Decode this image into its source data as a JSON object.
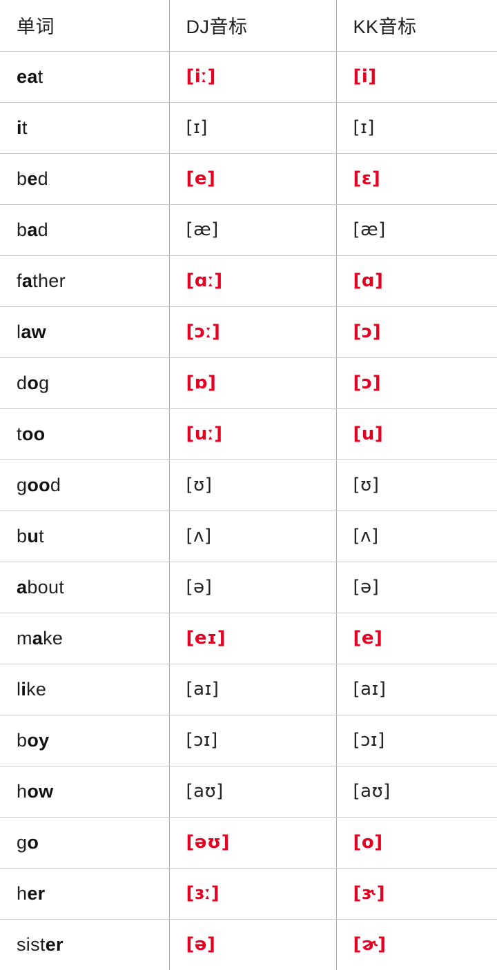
{
  "table": {
    "headers": {
      "word": "单词",
      "dj": "DJ音标",
      "kk": "KK音标"
    },
    "accent_color": "#e30021",
    "text_color": "#232323",
    "rows": [
      {
        "word": "eat",
        "word_bold": "ea",
        "word_rest": "t",
        "dj": "[iː]",
        "kk": "[i]",
        "dj_accent": true,
        "kk_accent": true
      },
      {
        "word": "it",
        "word_bold": "i",
        "word_rest": "t",
        "dj": "[ɪ]",
        "kk": "[ɪ]",
        "dj_accent": false,
        "kk_accent": false
      },
      {
        "word": "bed",
        "word_bold": "e",
        "word_rest": "d",
        "dj": "[e]",
        "kk": "[ɛ]",
        "dj_accent": true,
        "kk_accent": true
      },
      {
        "word": "bad",
        "word_bold": "a",
        "word_rest": "d",
        "dj": "[æ]",
        "kk": "[æ]",
        "dj_accent": false,
        "kk_accent": false
      },
      {
        "word": "father",
        "word_bold": "a",
        "word_rest": "ther",
        "dj": "[ɑː]",
        "kk": "[ɑ]",
        "dj_accent": true,
        "kk_accent": true
      },
      {
        "word": "law",
        "word_bold": "aw",
        "word_rest": "",
        "dj": "[ɔː]",
        "kk": "[ɔ]",
        "dj_accent": true,
        "kk_accent": true
      },
      {
        "word": "dog",
        "word_bold": "o",
        "word_rest": "g",
        "dj": "[ɒ]",
        "kk": "[ɔ]",
        "dj_accent": true,
        "kk_accent": true
      },
      {
        "word": "too",
        "word_bold": "oo",
        "word_rest": "",
        "dj": "[uː]",
        "kk": "[u]",
        "dj_accent": true,
        "kk_accent": true
      },
      {
        "word": "good",
        "word_bold": "oo",
        "word_rest": "d",
        "dj": "[ʊ]",
        "kk": "[ʊ]",
        "dj_accent": false,
        "kk_accent": false
      },
      {
        "word": "but",
        "word_bold": "u",
        "word_rest": "t",
        "dj": "[ʌ]",
        "kk": "[ʌ]",
        "dj_accent": false,
        "kk_accent": false
      },
      {
        "word": "about",
        "word_bold": "a",
        "word_rest": "bout",
        "dj": "[ə]",
        "kk": "[ə]",
        "dj_accent": false,
        "kk_accent": false
      },
      {
        "word": "make",
        "word_bold": "a",
        "word_rest": "ke",
        "dj": "[eɪ]",
        "kk": "[e]",
        "dj_accent": true,
        "kk_accent": true
      },
      {
        "word": "like",
        "word_bold": "i",
        "word_rest": "ke",
        "dj": "[aɪ]",
        "kk": "[aɪ]",
        "dj_accent": false,
        "kk_accent": false
      },
      {
        "word": "boy",
        "word_bold": "oy",
        "word_rest": "",
        "dj": "[ɔɪ]",
        "kk": "[ɔɪ]",
        "dj_accent": false,
        "kk_accent": false
      },
      {
        "word": "how",
        "word_bold": "ow",
        "word_rest": "",
        "dj": "[aʊ]",
        "kk": "[aʊ]",
        "dj_accent": false,
        "kk_accent": false
      },
      {
        "word": "go",
        "word_bold": "o",
        "word_rest": "",
        "dj": "[əʊ]",
        "kk": "[o]",
        "dj_accent": true,
        "kk_accent": true
      },
      {
        "word": "her",
        "word_bold": "er",
        "word_rest": "",
        "dj": "[ɜː]",
        "kk": "[ɝ]",
        "dj_accent": true,
        "kk_accent": true
      },
      {
        "word": "sister",
        "word_bold": "er",
        "word_rest": "",
        "dj": "[ə]",
        "kk": "[ɚ]",
        "dj_accent": true,
        "kk_accent": true
      }
    ],
    "row_word_prefix": [
      "",
      "",
      "b",
      "b",
      "f",
      "l",
      "d",
      "t",
      "g",
      "b",
      "",
      "m",
      "l",
      "b",
      "h",
      "g",
      "h",
      "sist"
    ]
  }
}
